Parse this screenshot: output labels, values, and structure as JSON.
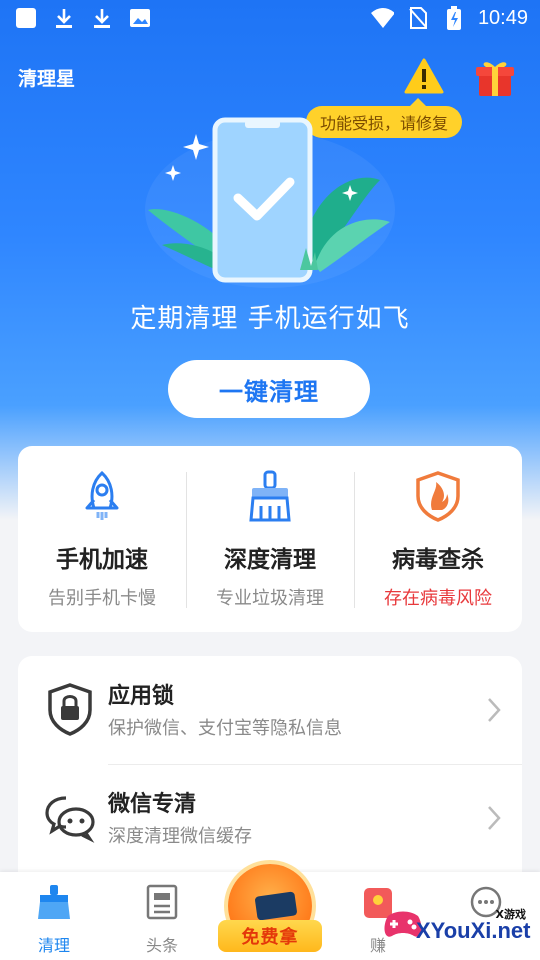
{
  "status_bar": {
    "time": "10:49",
    "left_icons": [
      "square-icon",
      "download-icon",
      "download-icon",
      "image-icon"
    ],
    "right_icons": [
      "wifi-icon",
      "no-sim-icon",
      "battery-charging-icon"
    ]
  },
  "header": {
    "title": "清理星",
    "warning_tooltip": "功能受损，请修复",
    "warning_icon": "warning-icon",
    "gift_icon": "gift-icon"
  },
  "hero": {
    "slogan": "定期清理 手机运行如飞",
    "button_label": "一键清理"
  },
  "features": [
    {
      "title": "手机加速",
      "subtitle": "告别手机卡慢",
      "icon": "rocket-icon",
      "subtitle_color": "#8a8a8a"
    },
    {
      "title": "深度清理",
      "subtitle": "专业垃圾清理",
      "icon": "brush-icon",
      "subtitle_color": "#8a8a8a"
    },
    {
      "title": "病毒查杀",
      "subtitle": "存在病毒风险",
      "icon": "shield-virus-icon",
      "subtitle_color": "#e8393c"
    }
  ],
  "list": [
    {
      "title": "应用锁",
      "subtitle": "保护微信、支付宝等隐私信息",
      "icon": "shield-lock-icon"
    },
    {
      "title": "微信专清",
      "subtitle": "深度清理微信缓存",
      "icon": "chat-bubbles-icon"
    }
  ],
  "bottom_nav": {
    "items": [
      {
        "label": "清理",
        "icon": "broom-icon",
        "active": true
      },
      {
        "label": "头条",
        "icon": "news-icon",
        "active": false
      },
      {
        "label": "赚",
        "icon": "earn-icon",
        "active": false
      },
      {
        "label": "",
        "icon": "more-icon",
        "active": false
      }
    ],
    "free_label": "免费拿"
  },
  "watermark": {
    "small": "X游戏",
    "text": "XYouXi.net"
  },
  "colors": {
    "primary": "#1e76f2",
    "danger": "#e8393c",
    "tooltip": "#ffd12a"
  }
}
